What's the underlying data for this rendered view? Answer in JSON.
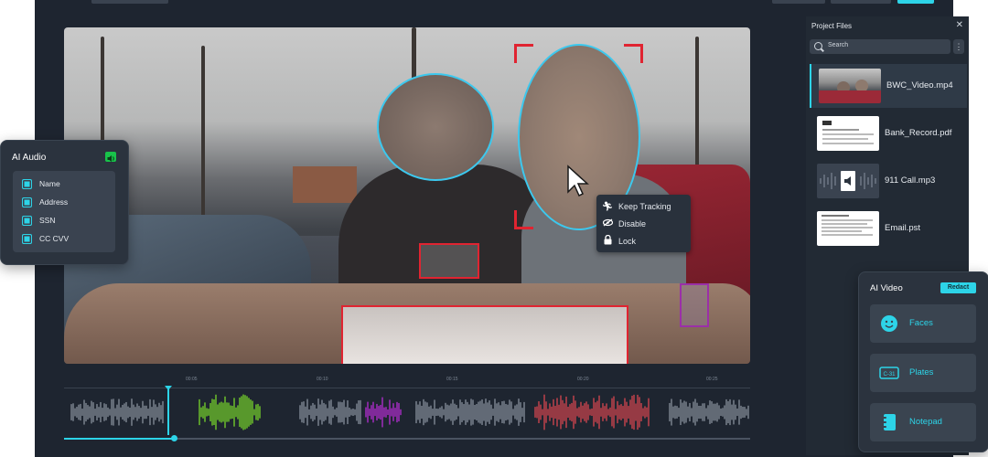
{
  "project_files": {
    "title": "Project Files",
    "search_placeholder": "Search",
    "files": [
      {
        "name": "BWC_Video.mp4",
        "active": true,
        "thumb": "video"
      },
      {
        "name": "Bank_Record.pdf",
        "active": false,
        "thumb": "document"
      },
      {
        "name": "911 Call.mp3",
        "active": false,
        "thumb": "audio"
      },
      {
        "name": "Email.pst",
        "active": false,
        "thumb": "document"
      }
    ]
  },
  "context_menu": {
    "items": [
      {
        "label": "Keep Tracking",
        "icon": "running-person-icon"
      },
      {
        "label": "Disable",
        "icon": "eye-slash-icon"
      },
      {
        "label": "Lock",
        "icon": "lock-icon"
      }
    ]
  },
  "ai_audio": {
    "title": "AI Audio",
    "items": [
      {
        "label": "Name",
        "checked": true
      },
      {
        "label": "Address",
        "checked": true
      },
      {
        "label": "SSN",
        "checked": true
      },
      {
        "label": "CC CVV",
        "checked": true
      }
    ]
  },
  "ai_video": {
    "title": "AI Video",
    "redact_label": "Redact",
    "options": [
      {
        "label": "Faces",
        "icon": "smiley-face-icon"
      },
      {
        "label": "Plates",
        "icon": "license-plate-icon"
      },
      {
        "label": "Notepad",
        "icon": "notepad-icon"
      }
    ]
  },
  "timeline": {
    "ticks": [
      "00:05",
      "00:10",
      "00:15",
      "00:20",
      "00:25"
    ],
    "progress_fraction": 0.16
  },
  "colors": {
    "accent": "#2dd4e8",
    "face_box": "#3cc8ee",
    "redaction_box": "#e02431",
    "purple_box": "#9b2fa8",
    "audio_green": "#7ee62a",
    "audio_magenta": "#c12fe0",
    "audio_red": "#e64a52"
  }
}
